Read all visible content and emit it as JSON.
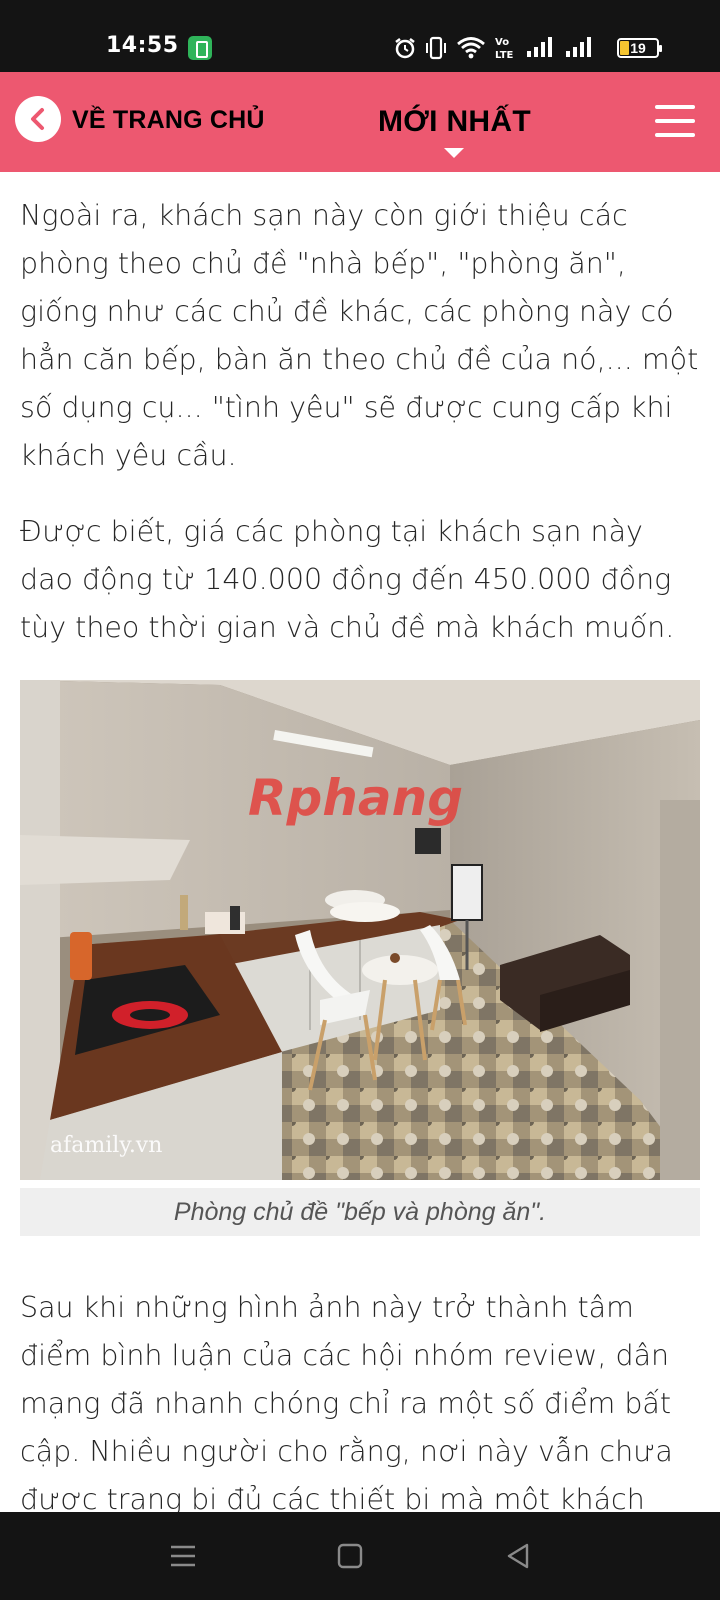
{
  "status_bar": {
    "time": "14:55",
    "battery_level": "19",
    "icons": [
      "app-notification-icon",
      "alarm-icon",
      "vibrate-icon",
      "wifi-icon",
      "volte-icon",
      "signal-icon",
      "signal-icon",
      "battery-icon"
    ]
  },
  "header": {
    "back_label": "VỀ TRANG CHỦ",
    "title": "MỚI NHẤT",
    "background_color": "#ed5870"
  },
  "article": {
    "paragraphs": [
      "Ngoài ra, khách sạn này còn giới thiệu các phòng theo chủ đề \"nhà bếp\", \"phòng ăn\", giống như các chủ đề khác, các phòng này có hẳn căn bếp, bàn ăn theo chủ đề của nó,... một số dụng cụ... \"tình yêu\" sẽ được cung cấp khi khách yêu cầu.",
      "Được biết, giá các phòng tại khách sạn này dao động từ 140.000 đồng đến 450.000 đồng tùy theo thời gian và chủ đề mà khách muốn.",
      "Sau khi những hình ảnh này trở thành tâm điểm bình luận của các hội nhóm review, dân mạng đã nhanh chóng chỉ ra một số điểm bất cập. Nhiều người cho rằng, nơi này vẫn chưa được trang bị đủ các thiết bị mà một khách sạn cần"
    ],
    "image": {
      "watermark_logo": "Rphang",
      "watermark_source": "afamily.vn",
      "caption": "Phòng chủ đề \"bếp và phòng ăn\"."
    }
  },
  "nav_bar": {
    "buttons": [
      "menu-nav-icon",
      "home-nav-icon",
      "back-nav-icon"
    ]
  }
}
